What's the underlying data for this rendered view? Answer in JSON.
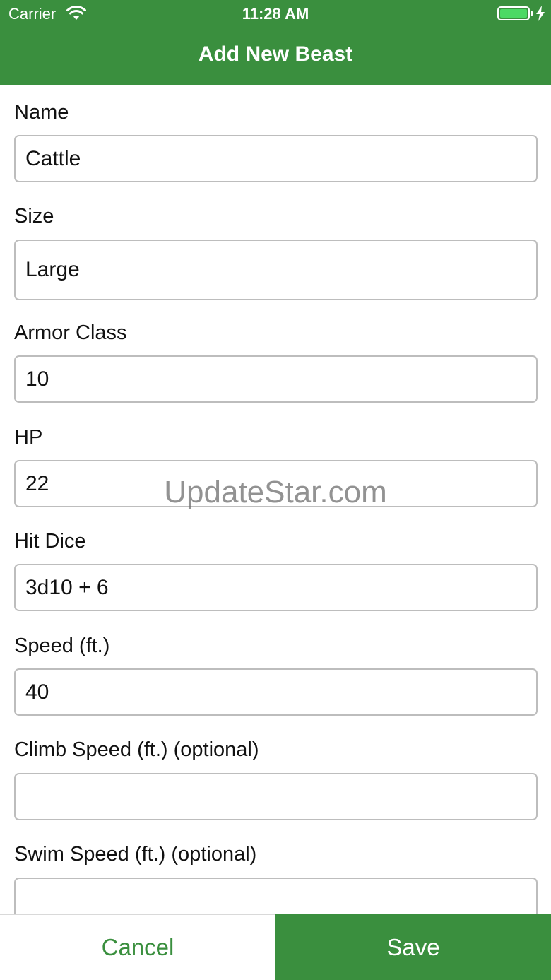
{
  "status_bar": {
    "carrier": "Carrier",
    "time": "11:28 AM",
    "battery_color": "#4cd964"
  },
  "header": {
    "title": "Add New Beast",
    "color": "#3a8f3e"
  },
  "form": {
    "fields": [
      {
        "label": "Name",
        "value": "Cattle"
      },
      {
        "label": "Size",
        "value": "Large"
      },
      {
        "label": "Armor Class",
        "value": "10"
      },
      {
        "label": "HP",
        "value": "22"
      },
      {
        "label": "Hit Dice",
        "value": "3d10 + 6"
      },
      {
        "label": "Speed (ft.)",
        "value": "40"
      },
      {
        "label": "Climb Speed (ft.) (optional)",
        "value": ""
      },
      {
        "label": "Swim Speed (ft.) (optional)",
        "value": ""
      }
    ]
  },
  "watermark": "UpdateStar.com",
  "actions": {
    "cancel_label": "Cancel",
    "save_label": "Save"
  }
}
